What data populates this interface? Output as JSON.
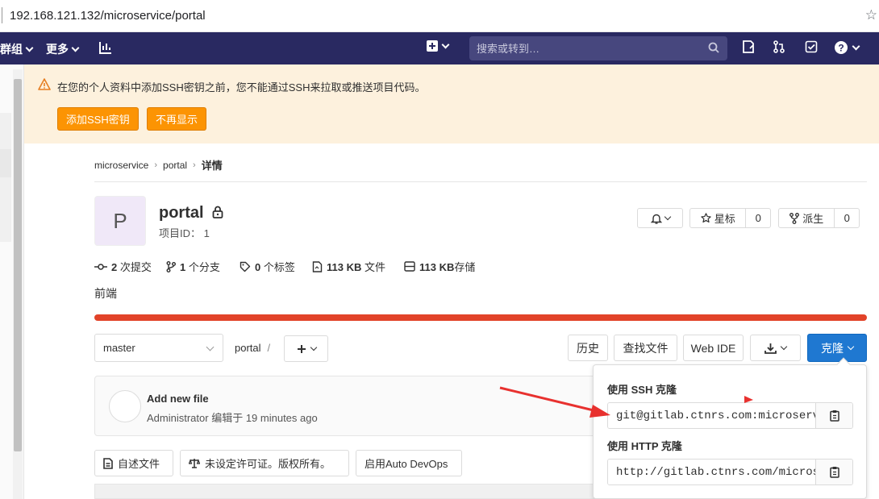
{
  "browser": {
    "url": "192.168.121.132/microservice/portal"
  },
  "navbar": {
    "groups_label": "群组",
    "more_label": "更多",
    "search_placeholder": "搜索或转到…"
  },
  "alert": {
    "message": "在您的个人资料中添加SSH密钥之前，您不能通过SSH来拉取或推送项目代码。",
    "add_ssh_label": "添加SSH密钥",
    "dismiss_label": "不再显示"
  },
  "breadcrumb": {
    "group": "microservice",
    "project": "portal",
    "current": "详情"
  },
  "project": {
    "avatar_letter": "P",
    "name": "portal",
    "id_text": "项目ID： 1",
    "description": "前端"
  },
  "actions": {
    "star_label": "星标",
    "star_count": "0",
    "fork_label": "派生",
    "fork_count": "0"
  },
  "stats": {
    "commits_num": "2",
    "commits_unit": "次提交",
    "branches_num": "1",
    "branches_unit": "个分支",
    "tags_num": "0",
    "tags_unit": "个标签",
    "files_num": "113 KB",
    "files_unit": "文件",
    "storage_num": "113 KB",
    "storage_unit": "存储"
  },
  "toolbar": {
    "branch": "master",
    "path": "portal",
    "slash": "/",
    "history": "历史",
    "find_file": "查找文件",
    "web_ide": "Web IDE",
    "clone": "克隆"
  },
  "commit": {
    "title": "Add new file",
    "author": "Administrator",
    "meta_rest": "编辑于 19 minutes ago"
  },
  "files_bar": {
    "readme": "自述文件",
    "license": "未设定许可证。版权所有。",
    "auto_devops": "启用Auto DevOps"
  },
  "clone_dropdown": {
    "ssh_label": "使用 SSH 克隆",
    "ssh_url": "git@gitlab.ctnrs.com:microservice/portal.git",
    "http_label": "使用 HTTP 克隆",
    "http_url": "http://gitlab.ctnrs.com/microservice/portal.git"
  },
  "colors": {
    "navbar": "#292961",
    "alert_bg": "#fdf1dd",
    "orange": "#fc9403",
    "language_bar": "#e24329",
    "clone_blue": "#1f78d1",
    "annotation_arrow": "#e8312f"
  }
}
